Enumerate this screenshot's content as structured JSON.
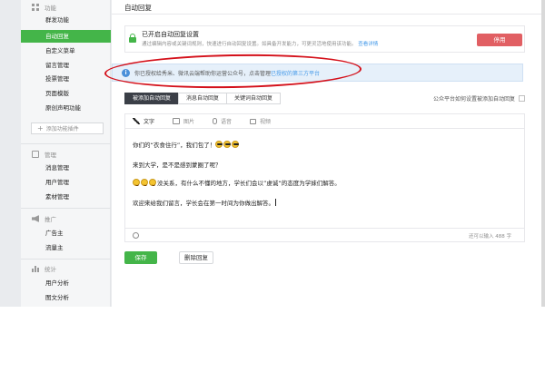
{
  "sidebar": {
    "groups": [
      {
        "label": "功能",
        "icon": "grid-icon"
      },
      {
        "label": "管理",
        "icon": "mail-icon"
      },
      {
        "label": "推广",
        "icon": "speaker-icon"
      },
      {
        "label": "统计",
        "icon": "stats-icon"
      }
    ],
    "items": [
      {
        "label": "群发功能"
      },
      {
        "label": "自动回复"
      },
      {
        "label": "自定义菜单"
      },
      {
        "label": "留言管理"
      },
      {
        "label": "投票管理"
      },
      {
        "label": "页面模版"
      },
      {
        "label": "原创声明功能"
      },
      {
        "label": "消息管理"
      },
      {
        "label": "用户管理"
      },
      {
        "label": "素材管理"
      },
      {
        "label": "广告主"
      },
      {
        "label": "流量主"
      },
      {
        "label": "用户分析"
      },
      {
        "label": "图文分析"
      }
    ],
    "add_plugin_label": "添加功能插件",
    "active_item": "自动回复"
  },
  "main": {
    "title": "自动回复",
    "notice": {
      "title": "已开启自动回复设置",
      "desc": "通过编辑内容或关键词规则，快速进行自动回复设置。如具备开发能力，可更灵活地使用该功能。",
      "link": "查看详情",
      "button_label": "停用"
    },
    "info_bar": {
      "text": "你已授权给秀米、微讯云端帮助你运营公众号，点击管理",
      "link": "已授权的第三方平台"
    },
    "tabs": [
      {
        "label": "被添加自动回复",
        "active": true
      },
      {
        "label": "消息自动回复",
        "active": false
      },
      {
        "label": "关键词自动回复",
        "active": false
      }
    ],
    "tab_right_label": "公众平台如何设置被添加自动回复",
    "editor": {
      "toolbar": [
        {
          "label": "文字",
          "icon": "pen-icon"
        },
        {
          "label": "图片",
          "icon": "image-icon"
        },
        {
          "label": "语音",
          "icon": "voice-icon"
        },
        {
          "label": "视频",
          "icon": "video-icon"
        }
      ],
      "lines": [
        "你们的“衣食住行”，我们包了！",
        "来到大学，是不是感到蒙圈了呢？",
        "没关系，有什么不懂的地方，学长们会以”虔诚“的态度为学妹们解答。",
        "欢迎来给我们留言，学长会在第一时间为你做出解答。"
      ],
      "char_count": "还可以输入 488 字"
    },
    "save_label": "保存",
    "delete_label": "删除回复"
  },
  "colors": {
    "accent_green": "#44b549",
    "danger_red": "#e15f63",
    "link_blue": "#459ae9",
    "annotation_red": "#d4101a"
  }
}
